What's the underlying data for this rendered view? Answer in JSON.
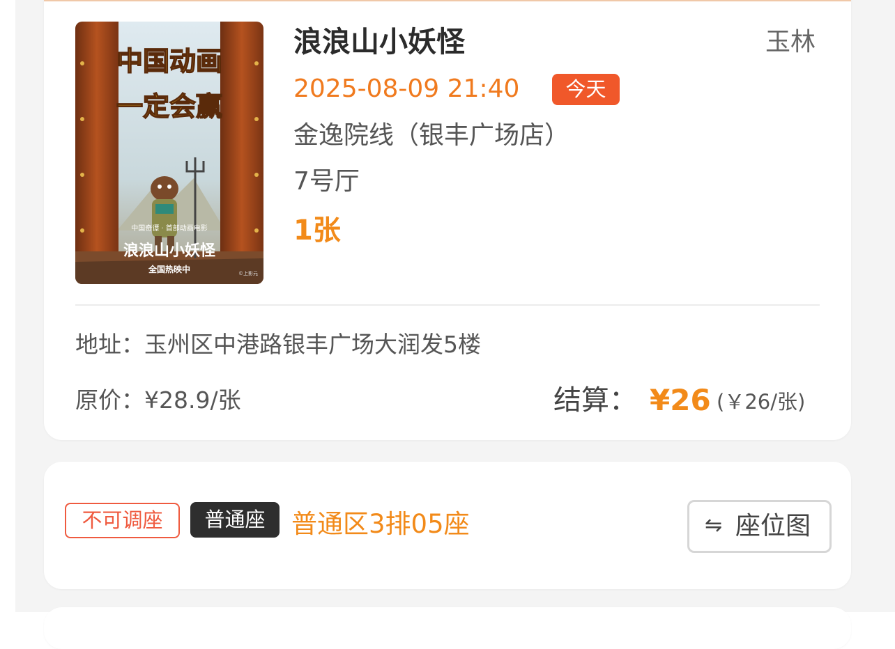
{
  "movie": {
    "title": "浪浪山小妖怪",
    "city": "玉林",
    "showtime": "2025-08-09 21:40",
    "today_badge": "今天",
    "cinema": "金逸院线（银丰广场店）",
    "hall": "7号厅",
    "ticket_count": "1张",
    "poster": {
      "headline_line1": "中国动画",
      "headline_line2": "一定会赢",
      "tagline": "中国奇谭 · 首部动画电影",
      "logo_text": "浪浪山小妖怪",
      "status": "全国热映中",
      "copyright": "©上影元"
    }
  },
  "order": {
    "address": "地址：玉州区中港路银丰广场大润发5楼",
    "original_price": "原价：¥28.9/张",
    "settle_label": "结算：",
    "settle_amount": "¥26",
    "settle_unit": "(￥26/张)"
  },
  "seat": {
    "no_adjust_tag": "不可调座",
    "seat_type": "普通座",
    "seat_text": "普通区3排05座",
    "seatmap_icon": "swap-arrows-icon",
    "seatmap_label": "座位图"
  },
  "colors": {
    "accent_orange": "#f28a19",
    "badge_red": "#f0582a",
    "tag_red": "#ef5a3f",
    "dark_tag": "#2e2e2e"
  }
}
